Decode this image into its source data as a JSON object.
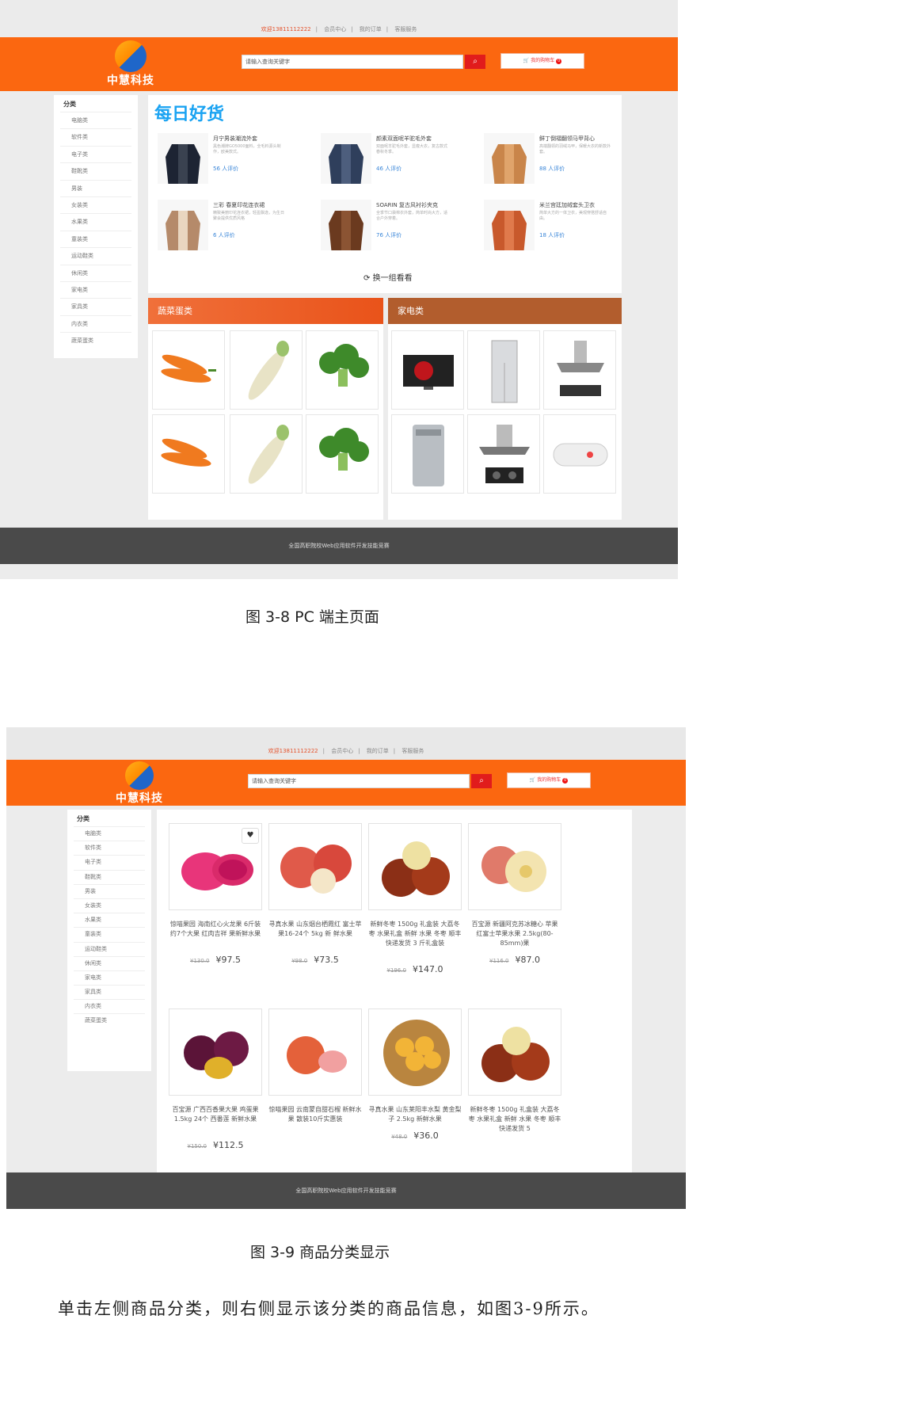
{
  "fig1": {
    "topbar": {
      "welcome": "欢迎13811112222",
      "member": "会员中心",
      "orders": "我的订单",
      "service": "客服服务"
    },
    "logo_text": "中慧科技",
    "search_placeholder": "请输入查询关键字",
    "cart_label": "我的购物车",
    "cart_count": "0",
    "sidebar_title": "分类",
    "categories": [
      "电脑类",
      "软件类",
      "电子类",
      "鞋靴类",
      "男装",
      "女装类",
      "水果类",
      "童装类",
      "运动鞋类",
      "休闲类",
      "家电类",
      "家具类",
      "内衣类",
      "蔬菜蛋类"
    ],
    "daily_title": "每日好货",
    "goods": [
      {
        "name": "月宁男装潮流外套",
        "desc": "黑色潮牌GO5000面料，全毛料源头制作，欧美款式。",
        "reviews": "56 人评价"
      },
      {
        "name": "颜素双面呢羊驼毛外套",
        "desc": "双面呢羊驼毛外套，显瘦大衣，复古款式春秋冬季。",
        "reviews": "46 人评价"
      },
      {
        "name": "鲜丁倒褶翻领马甲背心",
        "desc": "高端翻领的羽绒马甲，保暖大衣的新款外套。",
        "reviews": "88 人评价"
      },
      {
        "name": "三彩 春夏印花连衣裙",
        "desc": "精致美丽印花连衣裙，轻盈飘逸，为生日聚会提供优质风格",
        "reviews": "6 人评价"
      },
      {
        "name": "SOARIN 复古风衬衫夹克",
        "desc": "全季节口袋棉衣外套，简单时尚大方，适合户外穿着。",
        "reviews": "76 人评价"
      },
      {
        "name": "米兰宫廷加绒套头卫衣",
        "desc": "简单大方的一体卫衣，美观穿搭舒适自由。",
        "reviews": "18 人评价"
      }
    ],
    "refresh": "换一组看看",
    "cat1": "蔬菜蛋类",
    "cat2": "家电类",
    "footer": "全国高职院校Web应用软件开发技能竞赛"
  },
  "caption1": "图 3-8  PC 端主页面",
  "fig2": {
    "topbar": {
      "welcome": "欢迎13811112222",
      "member": "会员中心",
      "orders": "我的订单",
      "service": "客服服务"
    },
    "logo_text": "中慧科技",
    "search_placeholder": "请输入查询关键字",
    "cart_label": "我的购物车",
    "cart_count": "0",
    "sidebar_title": "分类",
    "categories": [
      "电脑类",
      "软件类",
      "电子类",
      "鞋靴类",
      "男装",
      "女装类",
      "水果类",
      "童装类",
      "运动鞋类",
      "休闲类",
      "家电类",
      "家具类",
      "内衣类",
      "蔬菜蛋类"
    ],
    "products": [
      {
        "name": "惊喵果园 海南红心火龙果 6斤装约7个大果 红肉吉祥 果新鲜水果",
        "old": "¥130.0",
        "price": "¥97.5"
      },
      {
        "name": "寻真水果 山东烟台栖霞红 富士苹果16-24个 5kg 新 鲜水果",
        "old": "¥98.0",
        "price": "¥73.5"
      },
      {
        "name": "新鲜冬枣 1500g 礼盒装 大荔冬枣 水果礼盒 新鲜 水果 冬枣 顺丰快递发货 3 斤礼盒装",
        "old": "¥196.0",
        "price": "¥147.0"
      },
      {
        "name": "百宝源 新疆阿克苏冰糖心 苹果 红富士苹果水果 2.5kg(80-85mm)果",
        "old": "¥116.0",
        "price": "¥87.0"
      },
      {
        "name": "百宝源 广西百香果大果 鸡蛋果 1.5kg 24个 西番莲 新鲜水果",
        "old": "¥150.0",
        "price": "¥112.5"
      },
      {
        "name": "惊喵果园 云南蒙自甜石榴 新鲜水果 散装10斤实惠装",
        "old": "",
        "price": ""
      },
      {
        "name": "寻真水果 山东莱阳丰水梨 黄金梨子 2.5kg 新鲜水果",
        "old": "¥48.0",
        "price": "¥36.0"
      },
      {
        "name": "新鲜冬枣 1500g 礼盒装 大荔冬枣 水果礼盒 新鲜 水果 冬枣 顺丰快递发货 5",
        "old": "",
        "price": ""
      }
    ],
    "footer": "全国高职院校Web应用软件开发技能竞赛"
  },
  "caption2": "图 3-9  商品分类显示",
  "body_text": "单击左侧商品分类，则右侧显示该分类的商品信息，如图3-9所示。"
}
